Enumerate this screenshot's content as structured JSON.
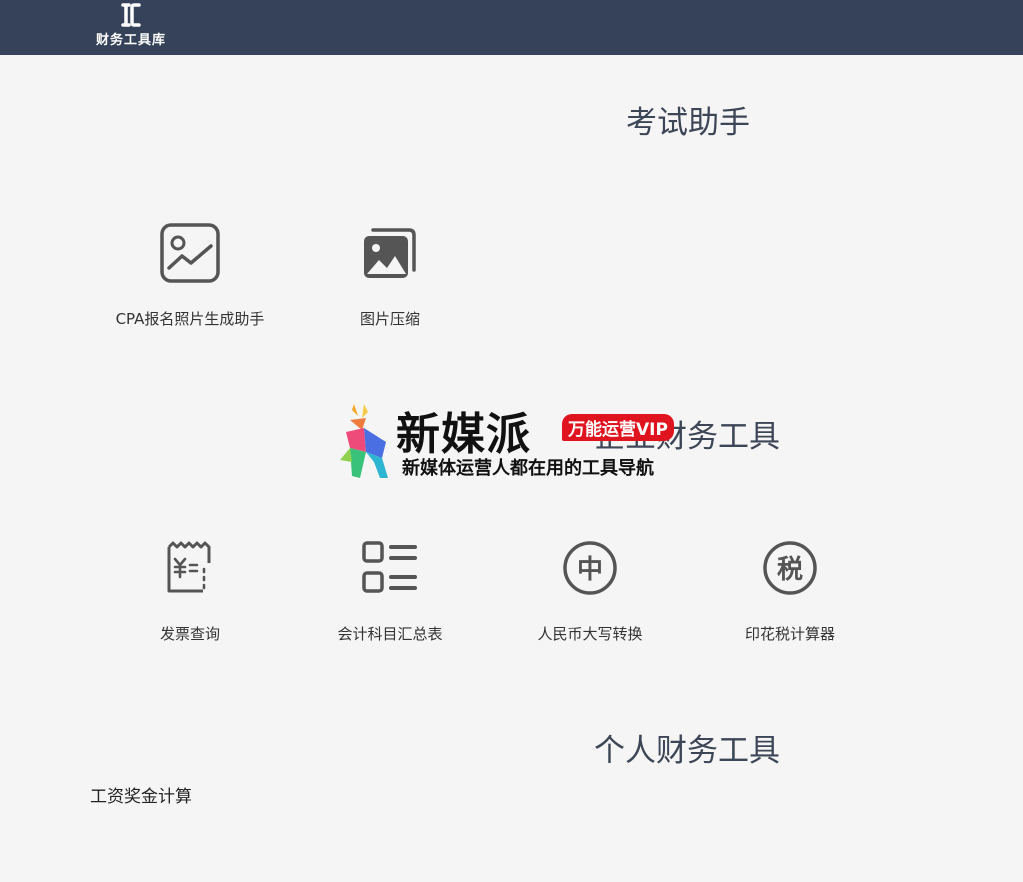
{
  "header": {
    "logo_text": "财务工具库"
  },
  "sections": {
    "exam": {
      "title": "考试助手",
      "tools": [
        {
          "label": "CPA报名照片生成助手",
          "icon": "photo-chart-icon"
        },
        {
          "label": "图片压缩",
          "icon": "image-stack-icon"
        }
      ]
    },
    "business": {
      "title": "企业财务工具",
      "tools": [
        {
          "label": "发票查询",
          "icon": "invoice-icon"
        },
        {
          "label": "会计科目汇总表",
          "icon": "list-icon"
        },
        {
          "label": "人民币大写转换",
          "icon": "zhong-circle-icon"
        },
        {
          "label": "印花税计算器",
          "icon": "shui-circle-icon"
        }
      ]
    },
    "personal": {
      "title": "个人财务工具",
      "tools": [
        {
          "label": "工资奖金计算"
        }
      ]
    }
  },
  "watermark": {
    "title": "新媒派",
    "badge": "万能运营VIP",
    "subtitle": "新媒体运营人都在用的工具导航"
  },
  "colors": {
    "header_bg": "#35425a",
    "icon_stroke": "#555555",
    "title_text": "#3d4657"
  }
}
